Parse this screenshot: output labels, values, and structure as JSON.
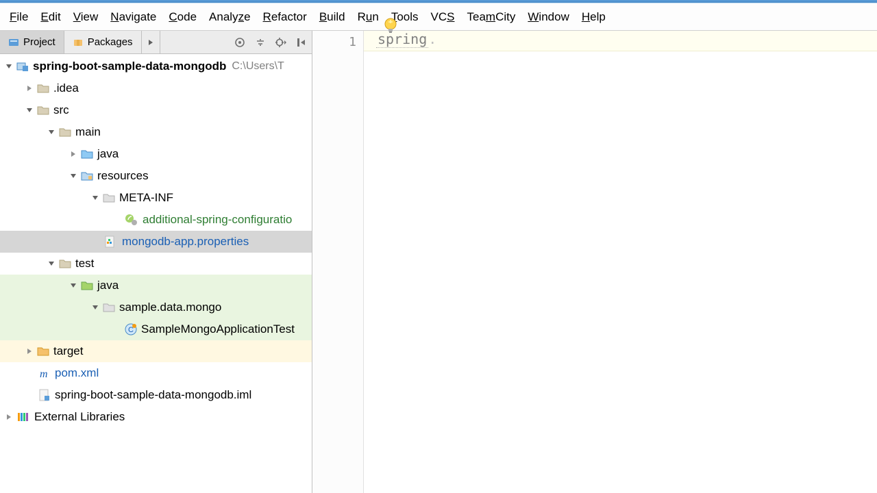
{
  "menubar": {
    "items": [
      {
        "html": "<u>F</u>ile"
      },
      {
        "html": "<u>E</u>dit"
      },
      {
        "html": "<u>V</u>iew"
      },
      {
        "html": "<u>N</u>avigate"
      },
      {
        "html": "<u>C</u>ode"
      },
      {
        "html": "Analy<u>z</u>e"
      },
      {
        "html": "<u>R</u>efactor"
      },
      {
        "html": "<u>B</u>uild"
      },
      {
        "html": "R<u>u</u>n"
      },
      {
        "html": "<u>T</u>ools"
      },
      {
        "html": "VC<u>S</u>"
      },
      {
        "html": "Tea<u>m</u>City"
      },
      {
        "html": "<u>W</u>indow"
      },
      {
        "html": "<u>H</u>elp"
      }
    ]
  },
  "panel": {
    "tabs": [
      {
        "label": "Project",
        "active": true
      },
      {
        "label": "Packages",
        "active": false
      }
    ]
  },
  "tree": {
    "root": {
      "name": "spring-boot-sample-data-mongodb",
      "path": "C:\\Users\\T"
    },
    "idea": ".idea",
    "src": "src",
    "main": "main",
    "java_main": "java",
    "resources": "resources",
    "meta_inf": "META-INF",
    "additional_cfg": "additional-spring-configuratio",
    "mongodb_props": "mongodb-app.properties",
    "test": "test",
    "java_test": "java",
    "sample_pkg": "sample.data.mongo",
    "sample_test": "SampleMongoApplicationTest",
    "target": "target",
    "pom": "pom.xml",
    "iml": "spring-boot-sample-data-mongodb.iml",
    "ext_lib": "External Libraries"
  },
  "editor": {
    "line_number": "1",
    "content": "spring",
    "dot": "."
  }
}
